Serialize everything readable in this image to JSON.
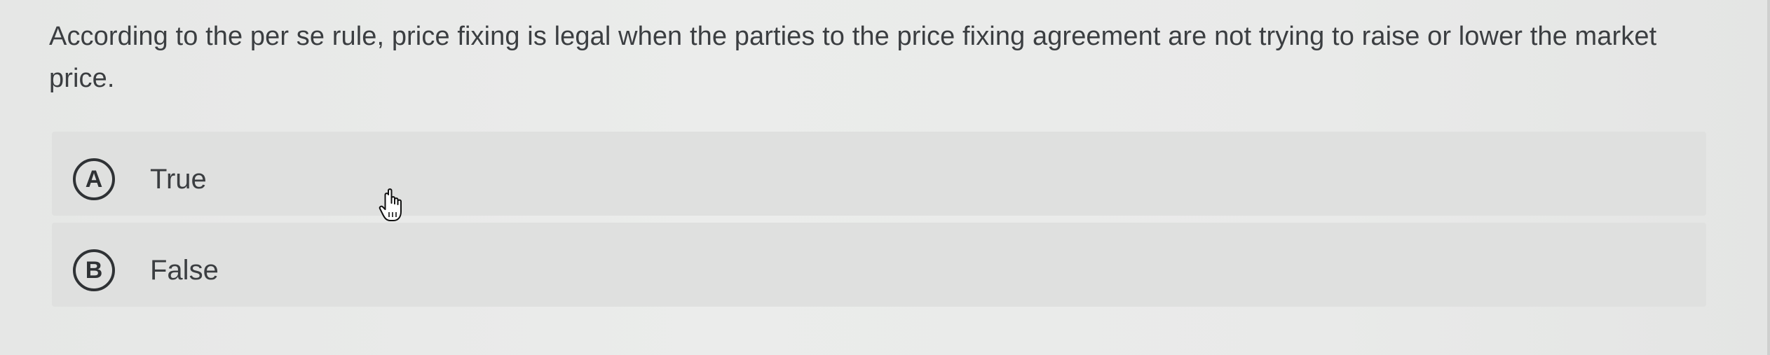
{
  "question": {
    "text": "According to the per se rule, price fixing is legal when the parties to the price fixing agreement are not trying to raise or lower the market price."
  },
  "options": [
    {
      "letter": "A",
      "label": "True"
    },
    {
      "letter": "B",
      "label": "False"
    }
  ],
  "icons": {
    "cursor": "hand-pointer-icon"
  },
  "colors": {
    "background": "#e8e9e8",
    "option_background": "#dfe0df",
    "text": "#3b3e41"
  }
}
